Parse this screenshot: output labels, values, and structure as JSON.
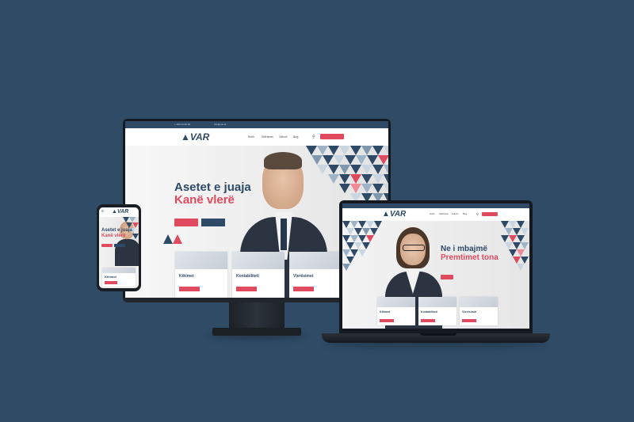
{
  "colors": {
    "background": "#2f4b66",
    "brand": "#2e4a66",
    "accent": "#e04a5f"
  },
  "brand": {
    "logo_text": "VAR"
  },
  "desktop": {
    "topbar": {
      "contact": "+ 000 00 00 00",
      "email": "info@var.al",
      "right": ""
    },
    "nav": {
      "items": [
        "Rreth",
        "Shërbimet",
        "Lidhuni",
        "Blog"
      ],
      "search_icon": "search-icon",
      "cta": ""
    },
    "hero": {
      "eyebrow": "",
      "title_line1": "Asetet e juaja",
      "title_line2": "Kanë vlerë",
      "text": "",
      "btn_primary": "",
      "btn_secondary": ""
    },
    "cards": [
      {
        "title": "Kthimet",
        "sub": "",
        "btn": ""
      },
      {
        "title": "Kontabiliteti",
        "sub": "",
        "btn": ""
      },
      {
        "title": "Vlerësimet",
        "sub": "",
        "btn": ""
      }
    ]
  },
  "phone": {
    "hero": {
      "title_line1": "Asetet e juaja",
      "title_line2": "Kanë vlerë"
    },
    "card": {
      "title": "Kthimet"
    }
  },
  "laptop": {
    "hero": {
      "title_line1": "Ne i mbajmë",
      "title_line2": "Premtimet tona"
    },
    "cards": [
      {
        "title": "Kthimet"
      },
      {
        "title": "Kontabiliteti"
      },
      {
        "title": "Vlerësimet"
      }
    ]
  }
}
